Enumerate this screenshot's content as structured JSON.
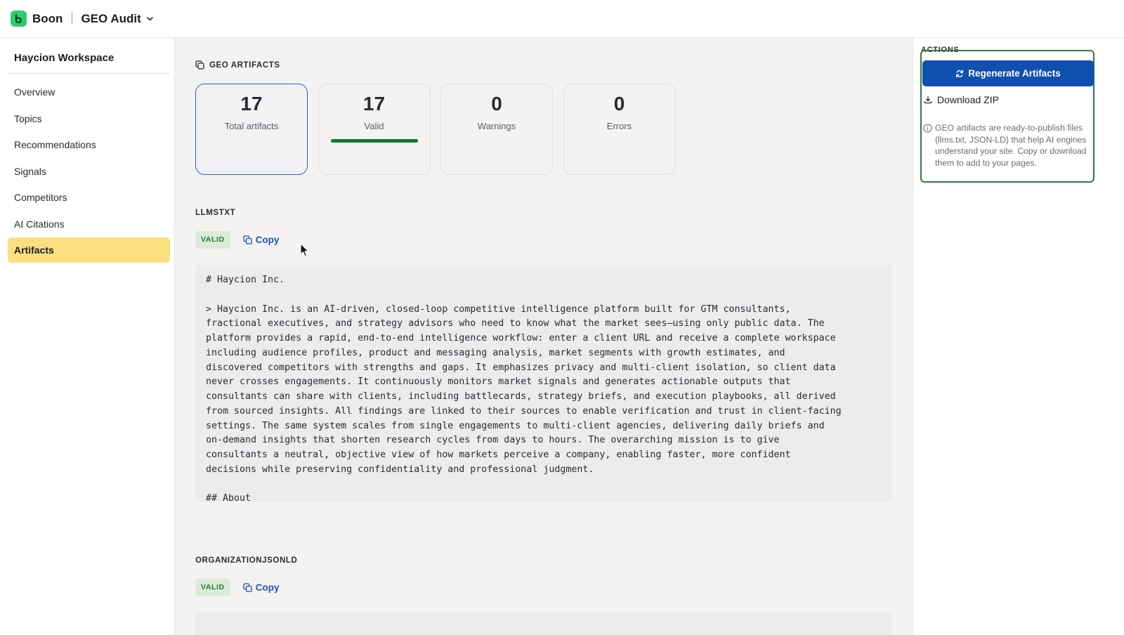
{
  "header": {
    "brand": "Boon",
    "product": "GEO Audit",
    "accent_color": "#2ecc71"
  },
  "sidebar": {
    "workspace": "Haycion Workspace",
    "items": [
      {
        "label": "Overview",
        "active": false
      },
      {
        "label": "Topics",
        "active": false
      },
      {
        "label": "Recommendations",
        "active": false
      },
      {
        "label": "Signals",
        "active": false
      },
      {
        "label": "Competitors",
        "active": false
      },
      {
        "label": "AI Citations",
        "active": false
      },
      {
        "label": "Artifacts",
        "active": true
      }
    ],
    "active_color": "#fbdf7e"
  },
  "main": {
    "section_title": "GEO ARTIFACTS",
    "stats": [
      {
        "value": "17",
        "label": "Total artifacts"
      },
      {
        "value": "17",
        "label": "Valid"
      },
      {
        "value": "0",
        "label": "Warnings"
      },
      {
        "value": "0",
        "label": "Errors"
      }
    ],
    "artifacts": [
      {
        "name": "LLMSTXT",
        "status": "VALID",
        "copy_label": "Copy",
        "content": "# Haycion Inc.\n\n> Haycion Inc. is an AI-driven, closed-loop competitive intelligence platform built for GTM consultants,\nfractional executives, and strategy advisors who need to know what the market sees—using only public data. The\nplatform provides a rapid, end-to-end intelligence workflow: enter a client URL and receive a complete workspace\nincluding audience profiles, product and messaging analysis, market segments with growth estimates, and\ndiscovered competitors with strengths and gaps. It emphasizes privacy and multi-client isolation, so client data\nnever crosses engagements. It continuously monitors market signals and generates actionable outputs that\nconsultants can share with clients, including battlecards, strategy briefs, and execution playbooks, all derived\nfrom sourced insights. All findings are linked to their sources to enable verification and trust in client-facing\nsettings. The same system scales from single engagements to multi-client agencies, delivering daily briefs and\non-demand insights that shorten research cycles from days to hours. The overarching mission is to give\nconsultants a neutral, objective view of how markets perceive a company, enabling faster, more confident\ndecisions while preserving confidentiality and professional judgment.\n\n## About"
      },
      {
        "name": "ORGANIZATIONJSONLD",
        "status": "VALID",
        "copy_label": "Copy"
      }
    ],
    "valid_bar_color": "#0f7a2e"
  },
  "actions": {
    "title": "ACTIONS",
    "regenerate_label": "Regenerate Artifacts",
    "download_label": "Download ZIP",
    "info_text": "GEO artifacts are ready-to-publish files (llms.txt, JSON-LD) that help AI engines understand your site. Copy or download them to add to your pages.",
    "primary_color": "#0f4fb0"
  }
}
